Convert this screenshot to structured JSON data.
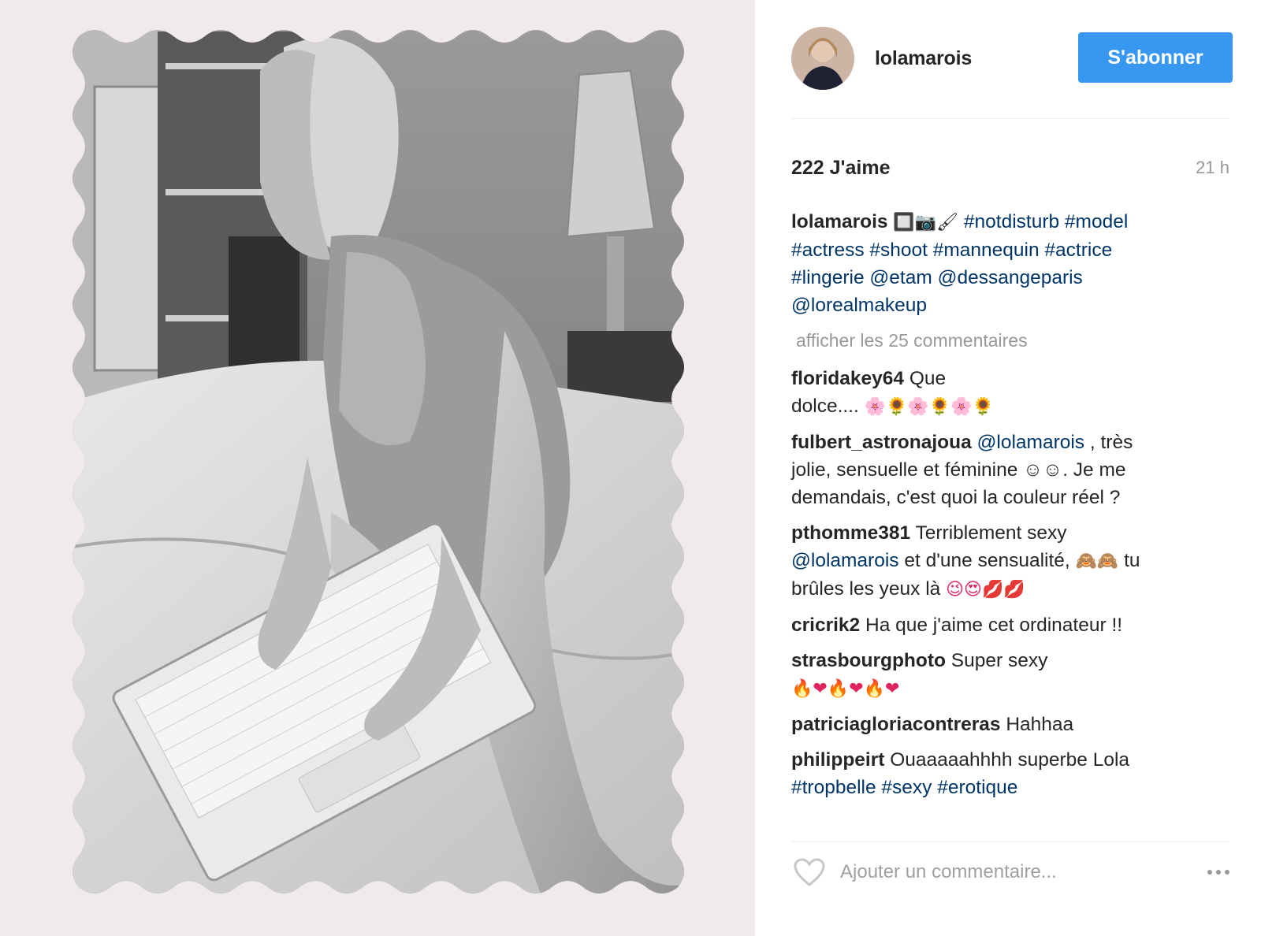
{
  "post": {
    "author": "lolamarois",
    "follow_label": "S'abonner",
    "likes": "222 J'aime",
    "time": "21 h"
  },
  "caption": {
    "user": "lolamarois",
    "emojis": "🔲📷🖌",
    "tags_line1": "#notdisturb #model",
    "tags_line2": "#actress #shoot #mannequin #actrice",
    "tags_line3": "#lingerie @etam @dessangeparis",
    "tags_line4": "@lorealmakeup"
  },
  "view_all_label": "afficher les 25 commentaires",
  "comments": [
    {
      "user": "floridakey64",
      "text1": "Que",
      "text2": "dolce....",
      "emojis": "🌸🌻🌸🌻🌸🌻"
    },
    {
      "user": "fulbert_astronajoua",
      "mention": "@lolamarois",
      "text1": " , très",
      "text2": "jolie, sensuelle et féminine ☺☺. Je me",
      "text3": "demandais, c'est quoi la couleur réel ?"
    },
    {
      "user": "pthomme381",
      "text1": " Terriblement sexy",
      "mention": "@lolamarois",
      "text2": " et d'une sensualité, ",
      "emojis1": "🙈🙈",
      "text3": " tu",
      "text4": "brûles les yeux là ",
      "emojis2": "😉😍💋💋"
    },
    {
      "user": "cricrik2",
      "text1": " Ha que j'aime cet ordinateur !!"
    },
    {
      "user": "strasbourgphoto",
      "text1": " Super sexy",
      "emojis": "🔥❤🔥❤🔥❤"
    },
    {
      "user": "patriciagloriacontreras",
      "text1": " Hahhaa"
    },
    {
      "user": "philippeirt",
      "text1": " Ouaaaaahhhh superbe Lola",
      "tags": "#tropbelle #sexy #erotique"
    }
  ],
  "add_comment": {
    "placeholder": "Ajouter un commentaire..."
  },
  "icons": {
    "like": "heart-outline-icon",
    "more": "more-options-icon"
  },
  "colors": {
    "follow_button": "#3897f0",
    "hashtag": "#003569",
    "muted": "#999999",
    "photo_background": "#f1eaea"
  }
}
